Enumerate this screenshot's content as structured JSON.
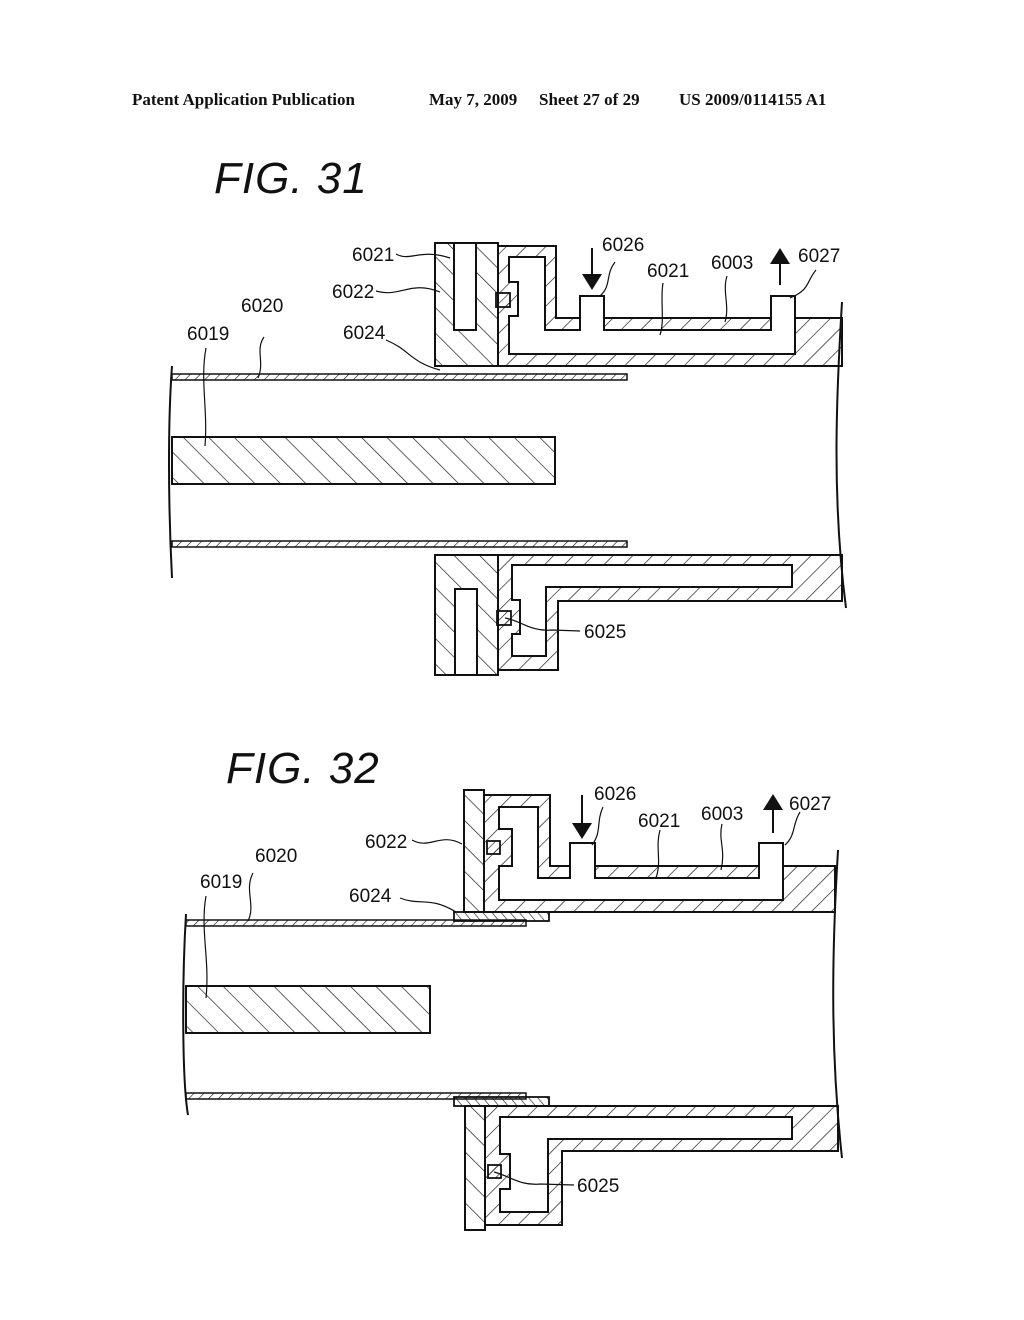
{
  "header": {
    "publication": "Patent Application Publication",
    "date": "May 7, 2009",
    "sheet": "Sheet 27 of 29",
    "number": "US 2009/0114155 A1"
  },
  "figures": [
    {
      "title": "FIG. 31",
      "labels": {
        "l6019": "6019",
        "l6020": "6020",
        "l6021a": "6021",
        "l6022": "6022",
        "l6024": "6024",
        "l6026": "6026",
        "l6021b": "6021",
        "l6003": "6003",
        "l6027": "6027",
        "l6025": "6025"
      },
      "arrows": {
        "inlet": "down-arrow",
        "outlet": "up-arrow"
      }
    },
    {
      "title": "FIG. 32",
      "labels": {
        "l6019": "6019",
        "l6020": "6020",
        "l6022": "6022",
        "l6024": "6024",
        "l6026": "6026",
        "l6021": "6021",
        "l6003": "6003",
        "l6027": "6027",
        "l6025": "6025"
      },
      "arrows": {
        "inlet": "down-arrow",
        "outlet": "up-arrow"
      }
    }
  ]
}
